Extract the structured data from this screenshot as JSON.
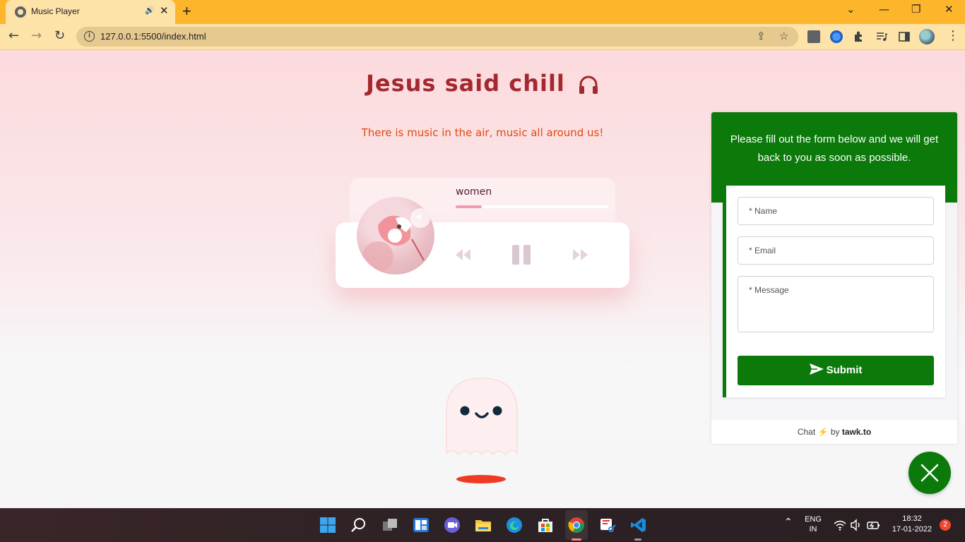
{
  "browser": {
    "tab_title": "Music Player",
    "tab_audio_icon": "speaker-icon",
    "new_tab_label": "+",
    "url": "127.0.0.1:5500/index.html"
  },
  "page": {
    "heading": "Jesus said chill",
    "tagline": "There is music in the air, music all around us!"
  },
  "player": {
    "song_title": "women",
    "progress": 0.17,
    "controls": [
      "rewind-icon",
      "pause-icon",
      "fast-forward-icon"
    ]
  },
  "chat": {
    "header_text": "Please fill out the form below and we will get back to you as soon as possible.",
    "name_placeholder": "* Name",
    "email_placeholder": "* Email",
    "message_placeholder": "* Message",
    "submit_label": "Submit",
    "footer_prefix": "Chat",
    "footer_by": "by",
    "footer_brand": "tawk.to",
    "accent_color": "#0b7a0b"
  },
  "taskbar": {
    "lang_line1": "ENG",
    "lang_line2": "IN",
    "time": "18:32",
    "date": "17-01-2022",
    "notification_count": "2"
  }
}
